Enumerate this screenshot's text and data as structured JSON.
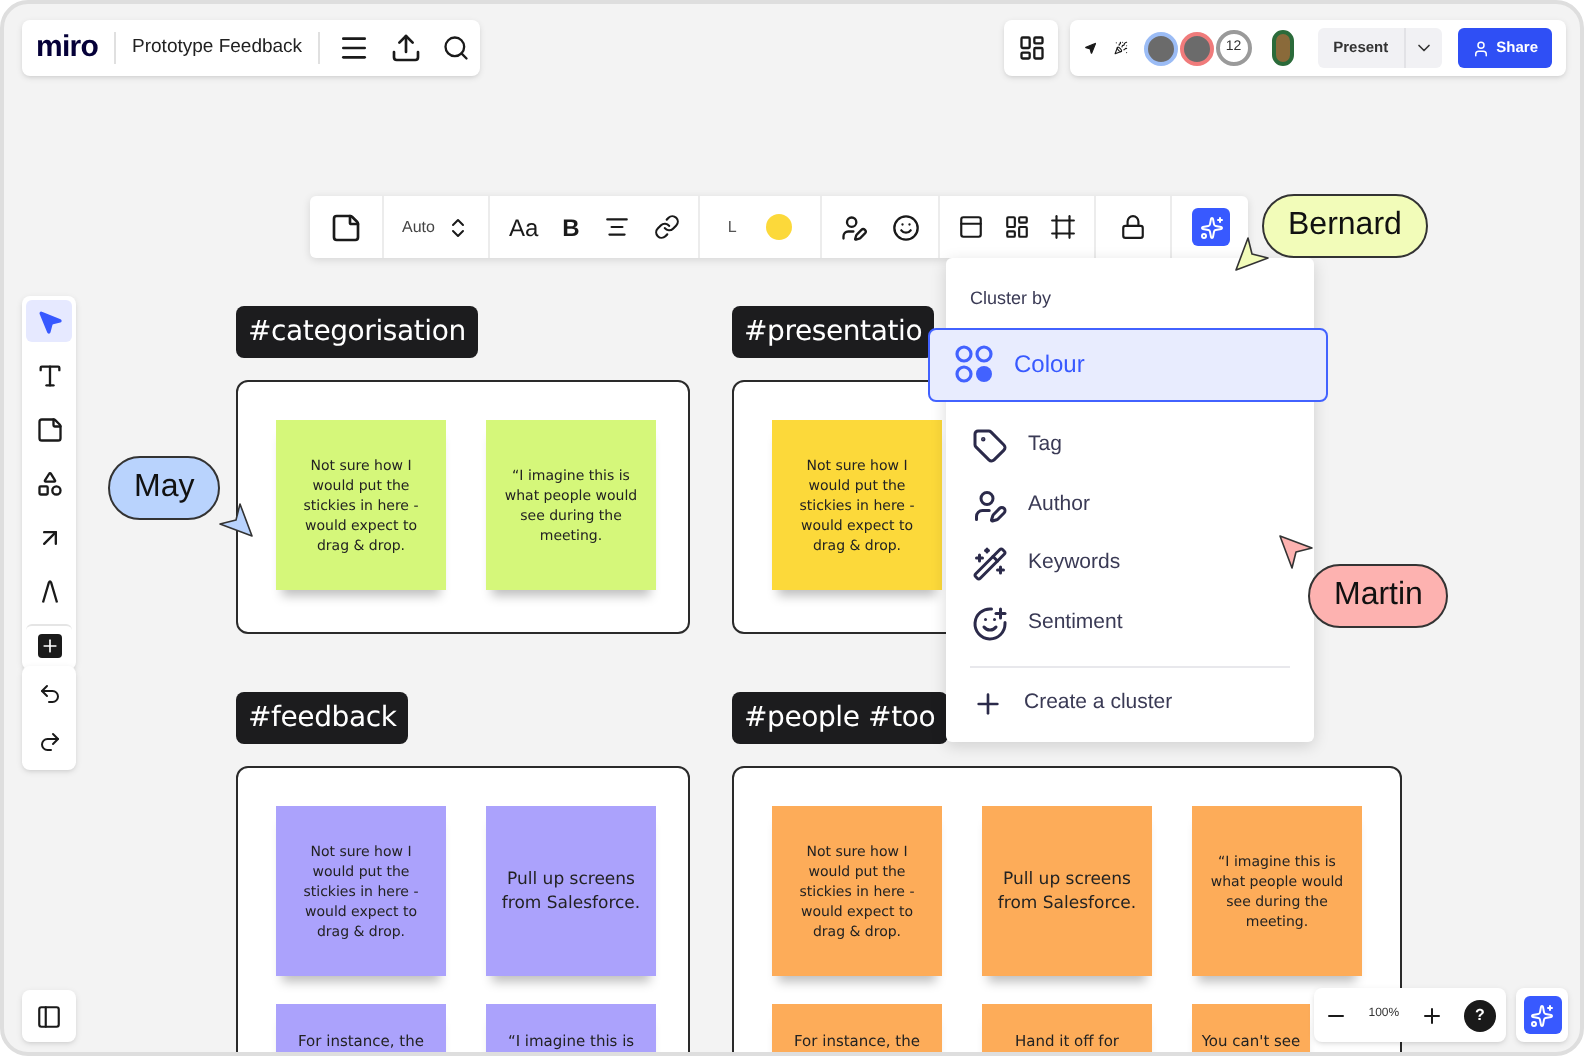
{
  "board_header": {
    "logo": "miro",
    "title": "Prototype Feedback"
  },
  "top_right": {
    "collaborators": [
      {
        "color": "#9bbcf5"
      },
      {
        "color": "#f07b7b"
      }
    ],
    "collaborator_count": "12",
    "present_button": "Present",
    "share_button": "Share"
  },
  "format_toolbar": {
    "size": "Auto",
    "font_label": "Aa",
    "bold_label": "B",
    "line_label": "L",
    "ai_selected": true
  },
  "left_toolbar": {
    "tools": [
      {
        "selected": true
      },
      {
        "selected": false
      },
      {
        "selected": false
      },
      {
        "selected": false
      },
      {
        "selected": false
      },
      {
        "selected": false
      },
      {
        "selected": false
      }
    ]
  },
  "frames": [
    {
      "tag": "#categorisation",
      "stickies": [
        {
          "text": "Not sure how I would put the stickies in here - would expect to drag & drop.",
          "color": "#d5f77a"
        },
        {
          "text": "“I imagine this is what people would see during the meeting.",
          "color": "#d5f77a"
        }
      ]
    },
    {
      "tag": "#presentatio",
      "stickies": [
        {
          "text": "Not sure how I would put the stickies in here - would expect to drag & drop.",
          "color": "#fcd93a"
        }
      ]
    },
    {
      "tag": "#feedback",
      "stickies": [
        {
          "text": "Not sure how I would put the stickies in here - would expect to drag & drop.",
          "color": "#aba2fc"
        },
        {
          "text": "Pull up screens from Salesforce.",
          "color": "#aba2fc"
        },
        {
          "text": "For instance, the",
          "color": "#aba2fc"
        },
        {
          "text": "“I imagine this is",
          "color": "#aba2fc"
        }
      ]
    },
    {
      "tag": "#people #too",
      "stickies": [
        {
          "text": "Not sure how I would put the stickies in here - would expect to drag & drop.",
          "color": "#fdac59"
        },
        {
          "text": "Pull up screens from Salesforce.",
          "color": "#fdac59"
        },
        {
          "text": "“I imagine this is what people would see during the meeting.",
          "color": "#fdac59"
        },
        {
          "text": "For instance, the",
          "color": "#fdac59"
        },
        {
          "text": "Hand it off for",
          "color": "#fdac59"
        },
        {
          "text": "You can't see",
          "color": "#fdac59"
        }
      ]
    }
  ],
  "cursors": [
    {
      "name": "May",
      "color": "#b9d3fd"
    },
    {
      "name": "Bernard",
      "color": "#f2fcb9"
    },
    {
      "name": "Martin",
      "color": "#fdb2b0"
    }
  ],
  "cluster_menu": {
    "title": "Cluster by",
    "options": [
      {
        "kind": "colour",
        "label": "Colour",
        "selected": true
      },
      {
        "kind": "tag",
        "label": "Tag",
        "selected": false
      },
      {
        "kind": "author",
        "label": "Author",
        "selected": false
      },
      {
        "kind": "keywords",
        "label": "Keywords",
        "selected": false
      },
      {
        "kind": "sentiment",
        "label": "Sentiment",
        "selected": false
      }
    ],
    "create_action": "Create a cluster"
  },
  "zoom_controls": {
    "zoom": "100%",
    "help": "?"
  }
}
